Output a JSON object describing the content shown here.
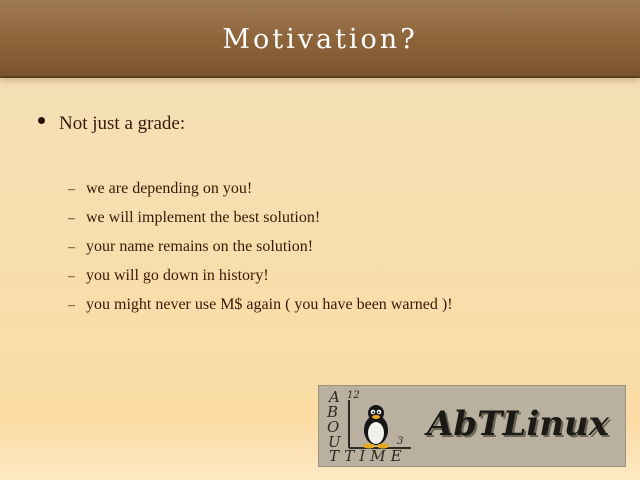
{
  "slide": {
    "title": "Motivation?",
    "main_bullet": "Not just a grade:",
    "sub_items": [
      "we are depending on you!",
      "we will implement the best solution!",
      "your name remains on the solution!",
      "you will go down in history!",
      "you might never use M$ again ( you have been warned )!"
    ]
  },
  "logo": {
    "text": "AbTLinux",
    "letters_vertical": [
      "A",
      "B",
      "O",
      "U",
      "T"
    ],
    "letters_bottom": "TIME",
    "clock_numbers": [
      "12",
      "3"
    ]
  },
  "colors": {
    "title_bar": "#8a6238",
    "text": "#3a1a08",
    "logo_bg": "#b9b09f"
  }
}
